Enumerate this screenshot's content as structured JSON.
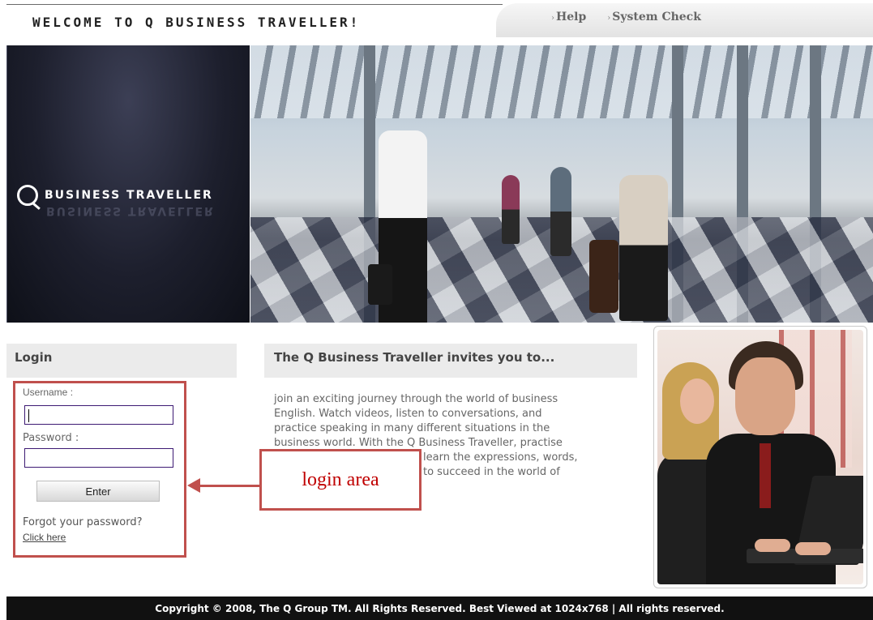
{
  "header": {
    "welcome_title": "WELCOME TO Q BUSINESS TRAVELLER!",
    "links": [
      {
        "label": "Help",
        "icon": "arrow-right-icon"
      },
      {
        "label": "System Check",
        "icon": "arrow-right-icon"
      }
    ]
  },
  "hero": {
    "logo_text": "BUSINESS TRAVELLER"
  },
  "login": {
    "title": "Login",
    "username_label": "Username :",
    "username_value": "",
    "password_label": "Password :",
    "password_value": "",
    "enter_label": "Enter",
    "forgot_text": "Forgot your password?",
    "click_here": "Click here"
  },
  "annotation": {
    "label": "login area",
    "color": "#c0504d"
  },
  "invite": {
    "title": "The Q Business Traveller invites you to...",
    "visible_lines": [
      "join an exciting journey through the world of business",
      "English. Watch videos, listen to conversations, and",
      "practice speaking in many different situations in the",
      "business world. With the Q Business Traveller, practise",
      "learn the expressions, words,",
      "to succeed in the world of"
    ]
  },
  "footer": {
    "text": "Copyright © 2008, The Q Group TM. All Rights Reserved. Best Viewed at 1024x768 | All rights reserved."
  }
}
